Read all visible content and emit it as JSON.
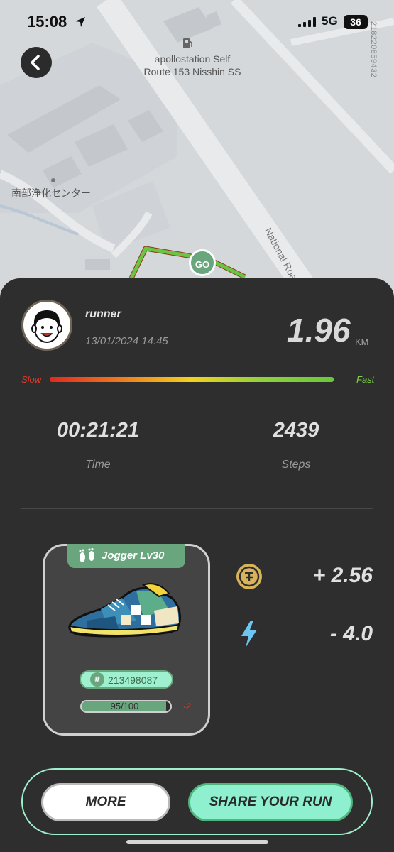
{
  "status_bar": {
    "time": "15:08",
    "network": "5G",
    "battery": "36"
  },
  "map": {
    "station_label_line1": "apollostation Self",
    "station_label_line2": "Route 153 Nisshin SS",
    "side_number": "218220859432",
    "place_label": "南部浄化センター",
    "road_label": "National Road",
    "start_marker": "GO"
  },
  "run": {
    "username": "runner",
    "datetime": "13/01/2024 14:45",
    "distance": "1.96",
    "distance_unit": "KM",
    "speed_slow_label": "Slow",
    "speed_fast_label": "Fast",
    "duration": "00:21:21",
    "duration_label": "Time",
    "steps": "2439",
    "steps_label": "Steps"
  },
  "sneaker": {
    "title": "Jogger Lv30",
    "id": "213498087",
    "durability_text": "95/100",
    "durability_fraction": 0.95,
    "durability_delta": "-2"
  },
  "rewards": {
    "coin": "+ 2.56",
    "energy": "- 4.0"
  },
  "actions": {
    "more_label": "MORE",
    "share_label": "SHARE YOUR RUN"
  },
  "colors": {
    "accent_green": "#6aa67d",
    "mint": "#8ef0ce",
    "panel": "#2e2e2e"
  }
}
